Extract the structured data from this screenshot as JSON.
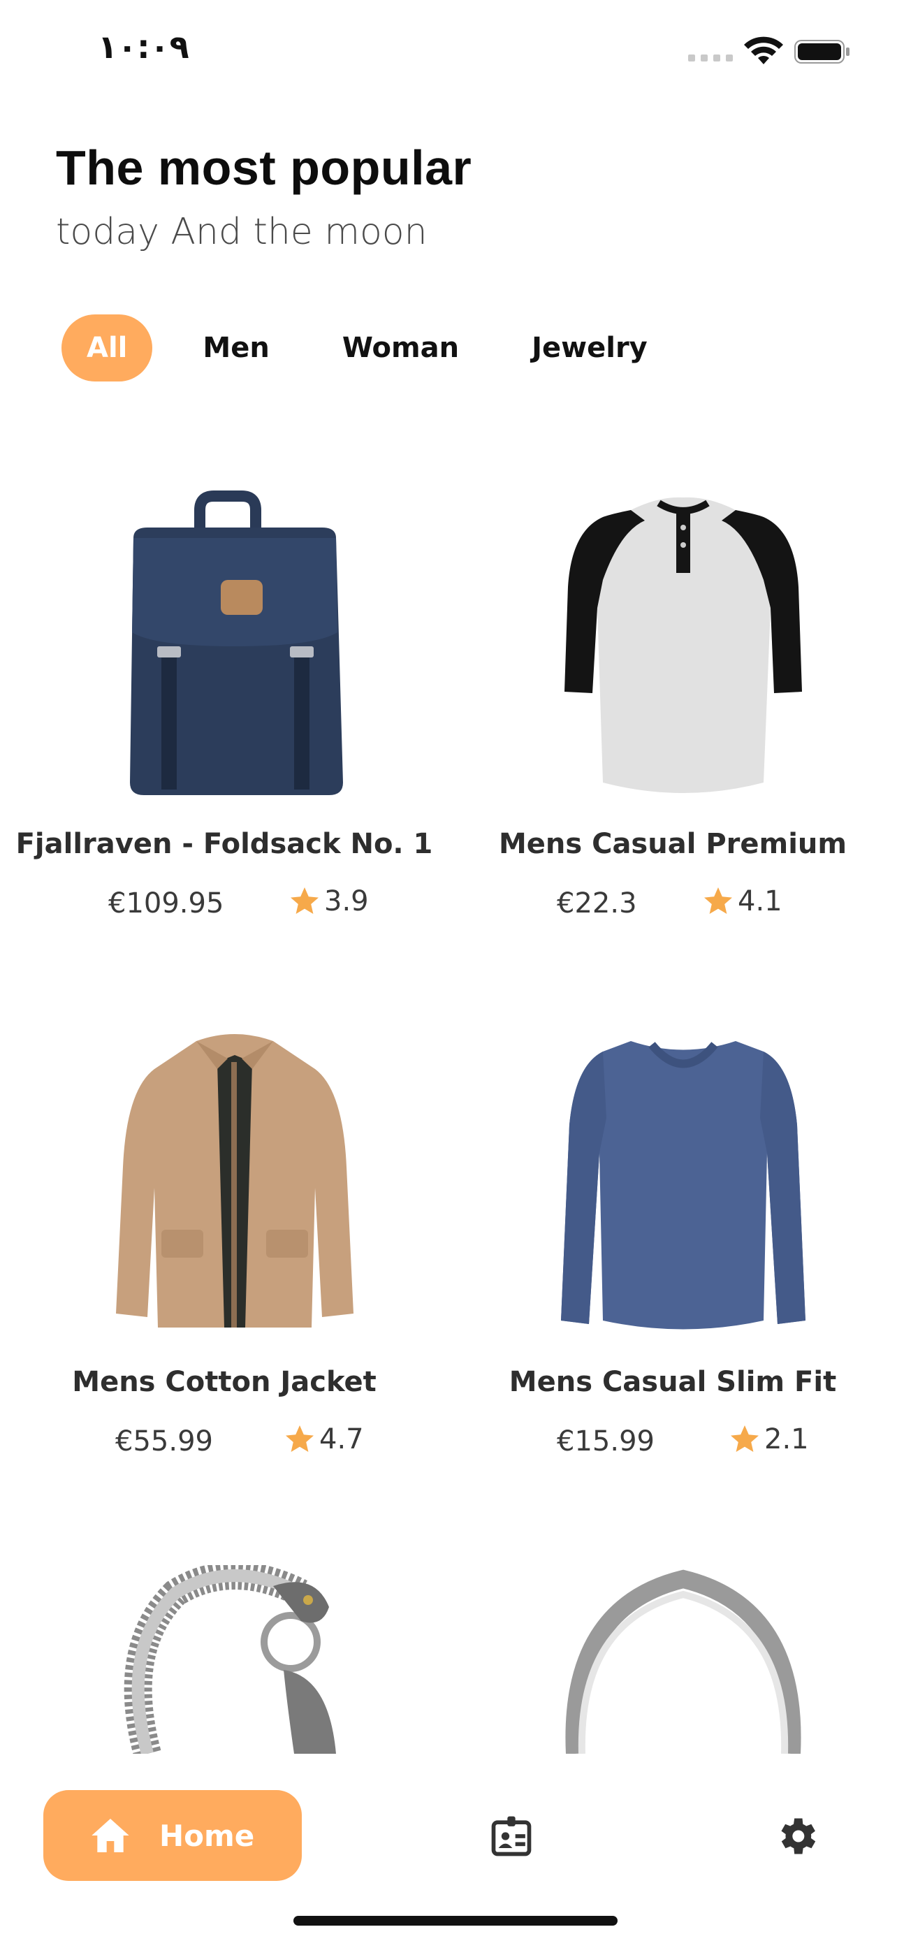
{
  "status_bar": {
    "time": "١٠:٠٩"
  },
  "header": {
    "title": "The most popular",
    "subtitle": "today And the moon"
  },
  "tabs": [
    {
      "label": "All",
      "active": true
    },
    {
      "label": "Men",
      "active": false
    },
    {
      "label": "Woman",
      "active": false
    },
    {
      "label": "Jewelry",
      "active": false
    }
  ],
  "products": [
    {
      "name": "Fjallraven - Foldsack No. 1",
      "price": "€109.95",
      "rating": "3.9",
      "image": "backpack-image"
    },
    {
      "name": "Mens Casual Premium",
      "price": "€22.3",
      "rating": "4.1",
      "image": "raglan-tshirt-image"
    },
    {
      "name": "Mens Cotton Jacket",
      "price": "€55.99",
      "rating": "4.7",
      "image": "jacket-image"
    },
    {
      "name": "Mens Casual Slim Fit",
      "price": "€15.99",
      "rating": "2.1",
      "image": "longsleeve-shirt-image"
    },
    {
      "image": "bracelet-image"
    },
    {
      "image": "ring-image"
    }
  ],
  "bottom_nav": {
    "home_label": "Home",
    "items": [
      "home-icon",
      "id-card-icon",
      "gear-icon"
    ]
  },
  "colors": {
    "accent": "#ffab5e",
    "star": "#f6a94a"
  }
}
